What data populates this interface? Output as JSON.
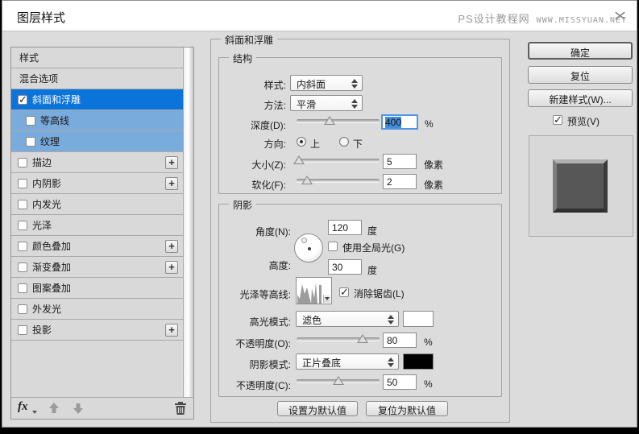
{
  "window": {
    "title": "图层样式"
  },
  "watermark": {
    "site": "PS设计教程网",
    "url": "www.missyuan.net",
    "xmark": "×"
  },
  "colors": {
    "accent_blue": "#0b74da",
    "sub_blue": "#79abdc",
    "highlight_swatch": "#ffffff",
    "shadow_swatch": "#000000"
  },
  "sidebar": {
    "items": [
      {
        "label": "样式",
        "checkbox": false,
        "checked": false,
        "variant": "normal",
        "plus": false
      },
      {
        "label": "混合选项",
        "checkbox": false,
        "checked": false,
        "variant": "normal",
        "plus": false
      },
      {
        "label": "斜面和浮雕",
        "checkbox": true,
        "checked": true,
        "variant": "selected",
        "plus": false
      },
      {
        "label": "等高线",
        "checkbox": true,
        "checked": false,
        "variant": "sub",
        "plus": false
      },
      {
        "label": "纹理",
        "checkbox": true,
        "checked": false,
        "variant": "sub",
        "plus": false
      },
      {
        "label": "描边",
        "checkbox": true,
        "checked": false,
        "variant": "normal",
        "plus": true
      },
      {
        "label": "内阴影",
        "checkbox": true,
        "checked": false,
        "variant": "normal",
        "plus": true
      },
      {
        "label": "内发光",
        "checkbox": true,
        "checked": false,
        "variant": "normal",
        "plus": false
      },
      {
        "label": "光泽",
        "checkbox": true,
        "checked": false,
        "variant": "normal",
        "plus": false
      },
      {
        "label": "颜色叠加",
        "checkbox": true,
        "checked": false,
        "variant": "normal",
        "plus": true
      },
      {
        "label": "渐变叠加",
        "checkbox": true,
        "checked": false,
        "variant": "normal",
        "plus": true
      },
      {
        "label": "图案叠加",
        "checkbox": true,
        "checked": false,
        "variant": "normal",
        "plus": false
      },
      {
        "label": "外发光",
        "checkbox": true,
        "checked": false,
        "variant": "normal",
        "plus": false
      },
      {
        "label": "投影",
        "checkbox": true,
        "checked": false,
        "variant": "normal",
        "plus": true
      }
    ],
    "footer": {
      "fx_label": "fx"
    }
  },
  "panel": {
    "title": "斜面和浮雕",
    "structure": {
      "legend": "结构",
      "style_label": "样式:",
      "style_value": "内斜面",
      "technique_label": "方法:",
      "technique_value": "平滑",
      "depth_label": "深度(D):",
      "depth_value": "400",
      "depth_unit": "%",
      "depth_thumb": "40%",
      "direction_label": "方向:",
      "dir_up": "上",
      "dir_down": "下",
      "size_label": "大小(Z):",
      "size_value": "5",
      "size_unit": "像素",
      "size_thumb": "3%",
      "soften_label": "软化(F):",
      "soften_value": "2",
      "soften_unit": "像素",
      "soften_thumb": "13%"
    },
    "shading": {
      "legend": "阴影",
      "angle_label": "角度(N):",
      "angle_value": "120",
      "angle_unit": "度",
      "global_light_label": "使用全局光(G)",
      "altitude_label": "高度:",
      "altitude_value": "30",
      "altitude_unit": "度",
      "gloss_label": "光泽等高线:",
      "antialias_label": "消除锯齿(L)",
      "highlight_mode_label": "高光模式:",
      "highlight_mode_value": "滤色",
      "highlight_color": "#ffffff",
      "opacity_label": "不透明度(O):",
      "opacity_value": "80",
      "opacity_unit": "%",
      "opacity_thumb": "80%",
      "shadow_mode_label": "阴影模式:",
      "shadow_mode_value": "正片叠底",
      "shadow_color": "#000000",
      "shadow_opacity_label": "不透明度(C):",
      "shadow_opacity_value": "50",
      "shadow_opacity_unit": "%",
      "shadow_opacity_thumb": "50%"
    },
    "footer_buttons": {
      "set_default": "设置为默认值",
      "reset_default": "复位为默认值"
    }
  },
  "actions": {
    "ok": "确定",
    "reset": "复位",
    "new_style": "新建样式(W)...",
    "preview": "预览(V)"
  }
}
